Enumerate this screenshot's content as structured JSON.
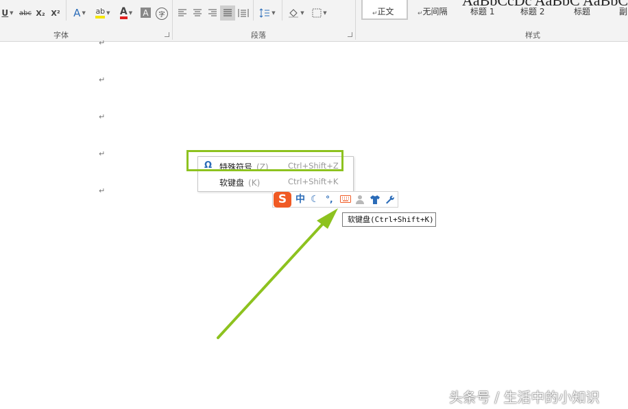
{
  "ribbon": {
    "font_group": {
      "label": "字体",
      "buttons": [
        "U",
        "abc",
        "X₂",
        "X²",
        "A",
        "ab",
        "A",
        "A",
        "字"
      ]
    },
    "paragraph_group": {
      "label": "段落"
    },
    "styles_group": {
      "label": "样式",
      "preview_text": "AaBbCcDc   AaBbC   AaBbC   Aal",
      "styles": [
        "正文",
        "无间隔",
        "标题 1",
        "标题 2",
        "标题",
        "副"
      ]
    }
  },
  "context_menu": {
    "items": [
      {
        "label": "特殊符号",
        "hotkey": "(Z)",
        "shortcut": "Ctrl+Shift+Z",
        "icon": "omega-icon"
      },
      {
        "label": "软键盘",
        "hotkey": "(K)",
        "shortcut": "Ctrl+Shift+K",
        "icon": ""
      }
    ]
  },
  "ime_bar": {
    "logo": "S",
    "mode": "中",
    "punct": "°,"
  },
  "tooltip": {
    "text": "软键盘(Ctrl+Shift+K)"
  },
  "watermark": {
    "text": "头条号 / 生活中的小知识"
  },
  "colors": {
    "highlight": "#8dc21f",
    "arrow": "#8dc21f",
    "sogou_orange": "#f05a24",
    "ime_blue": "#2b6cb8"
  }
}
